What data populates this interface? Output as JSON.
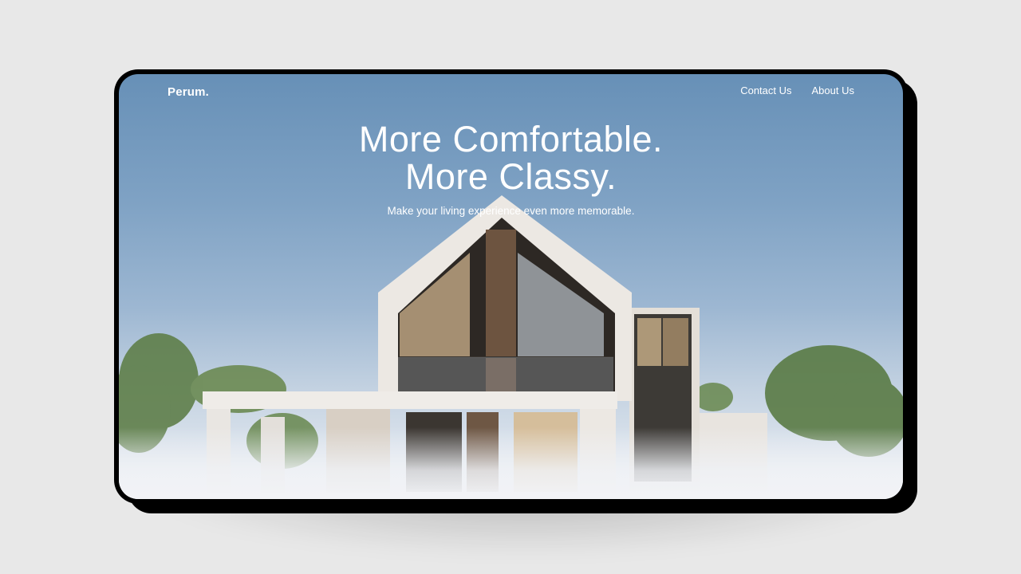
{
  "nav": {
    "logo": "Perum.",
    "links": [
      "Contact Us",
      "About Us"
    ]
  },
  "hero": {
    "title_line1": "More Comfortable.",
    "title_line2": "More Classy.",
    "subtitle": "Make your living experience even more memorable."
  },
  "colors": {
    "page_background": "#e8e8e8",
    "device_frame": "#000000",
    "sky_top": "#6790b7",
    "text": "#ffffff"
  }
}
